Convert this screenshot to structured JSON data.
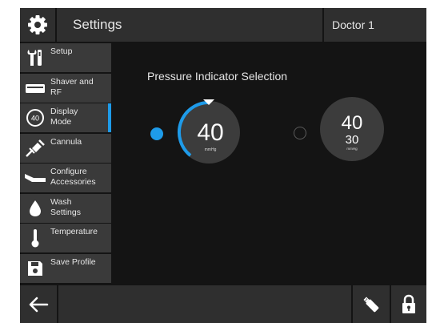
{
  "header": {
    "title": "Settings",
    "user": "Doctor 1",
    "gear_icon": "gear-icon"
  },
  "sidebar": {
    "items": [
      {
        "label": "Setup",
        "icon": "tools-icon",
        "active": false
      },
      {
        "label": "Shaver and\nRF",
        "icon": "shaver-icon",
        "active": false
      },
      {
        "label": "Display\nMode",
        "icon": "display-mode-icon",
        "icon_text": "40",
        "active": true
      },
      {
        "label": "Cannula",
        "icon": "cannula-icon",
        "active": false
      },
      {
        "label": "Configure\nAccessories",
        "icon": "accessories-icon",
        "active": false
      },
      {
        "label": "Wash\nSettings",
        "icon": "drop-icon",
        "active": false
      },
      {
        "label": "Temperature",
        "icon": "thermometer-icon",
        "active": false
      },
      {
        "label": "Save Profile",
        "icon": "floppy-disk-icon",
        "active": false
      }
    ]
  },
  "main": {
    "section_title": "Pressure Indicator Selection",
    "options": [
      {
        "name": "single-pressure",
        "selected": true,
        "value": "40",
        "unit": "mmHg"
      },
      {
        "name": "dual-pressure",
        "selected": false,
        "value": "40",
        "secondary_value": "30",
        "unit": "mmHg"
      }
    ]
  },
  "footer": {
    "back_icon": "back-arrow-icon",
    "usb_icon": "usb-drive-icon",
    "lock_icon": "lock-icon"
  },
  "colors": {
    "accent": "#1e9be9",
    "panel": "#2f2f2f",
    "background": "#141414",
    "dial": "#3c3c3c"
  }
}
